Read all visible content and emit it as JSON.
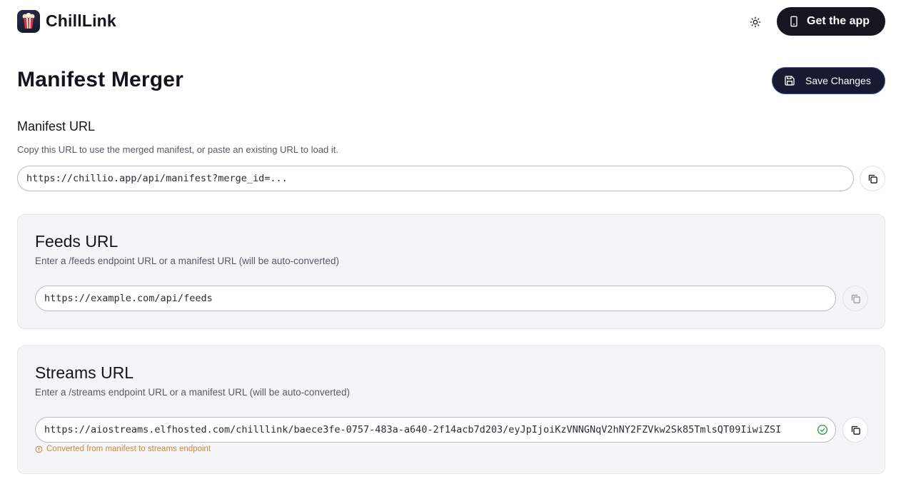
{
  "header": {
    "brand": "ChillLink",
    "get_app_label": "Get the app",
    "logo_icon": "popcorn-icon",
    "theme_icon": "sun-icon",
    "get_app_icon": "smartphone-icon"
  },
  "page": {
    "title": "Manifest Merger",
    "save_label": "Save Changes",
    "save_icon": "save-icon"
  },
  "manifest": {
    "title": "Manifest URL",
    "description": "Copy this URL to use the merged manifest, or paste an existing URL to load it.",
    "value": "https://chillio.app/api/manifest?merge_id=..."
  },
  "feeds": {
    "title": "Feeds URL",
    "description": "Enter a /feeds endpoint URL or a manifest URL (will be auto-converted)",
    "placeholder": "https://example.com/api/feeds"
  },
  "streams": {
    "title": "Streams URL",
    "description": "Enter a /streams endpoint URL or a manifest URL (will be auto-converted)",
    "value": "https://aiostreams.elfhosted.com/chilllink/baece3fe-0757-483a-a640-2f14acb7d203/eyJpIjoiKzVNNGNqV2hNY2FZVkw2Sk85TmlsQT09IiwiZSI",
    "note": "Converted from manifest to streams endpoint",
    "valid_icon": "check-circle-icon"
  },
  "colors": {
    "primary_dark": "#15161f",
    "save_button": "#181a33",
    "warning_text": "#c98a3a",
    "valid_green": "#22a04b",
    "card_bg": "#f5f5f7"
  }
}
